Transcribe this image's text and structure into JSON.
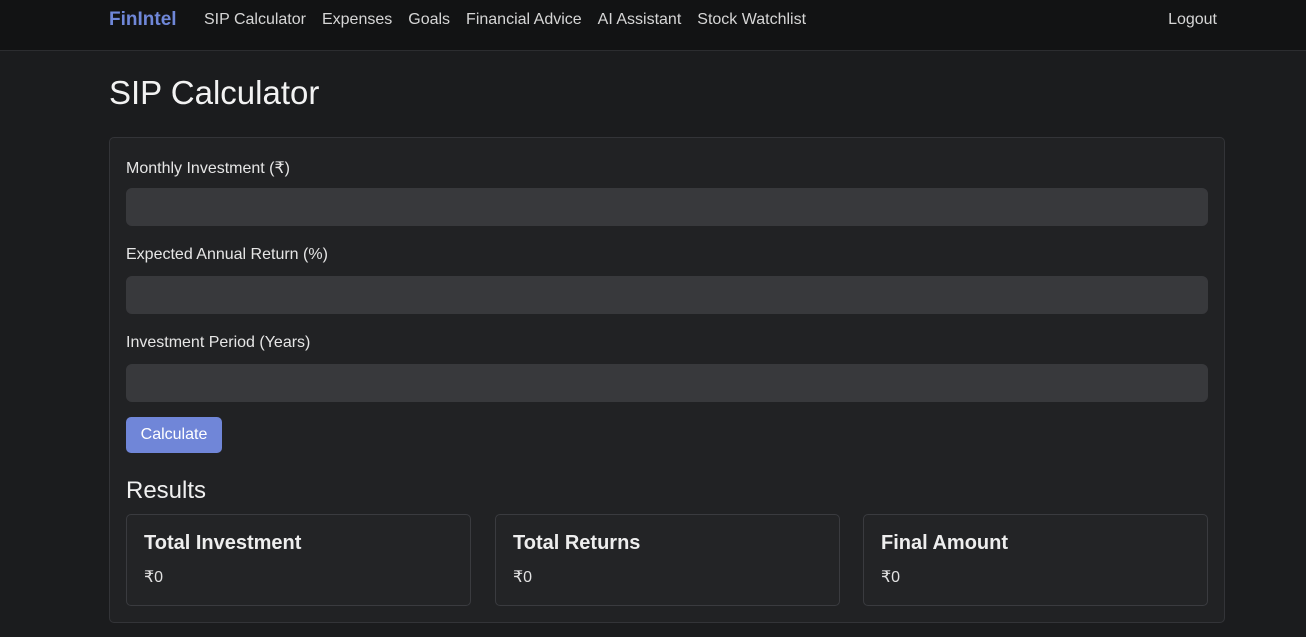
{
  "nav": {
    "brand": "FinIntel",
    "links": [
      {
        "label": "SIP Calculator"
      },
      {
        "label": "Expenses"
      },
      {
        "label": "Goals"
      },
      {
        "label": "Financial Advice"
      },
      {
        "label": "AI Assistant"
      },
      {
        "label": "Stock Watchlist"
      }
    ],
    "logout": "Logout"
  },
  "page": {
    "title": "SIP Calculator"
  },
  "form": {
    "monthly_investment": {
      "label": "Monthly Investment (₹)",
      "value": "",
      "placeholder": ""
    },
    "annual_return": {
      "label": "Expected Annual Return (%)",
      "value": "",
      "placeholder": ""
    },
    "period": {
      "label": "Investment Period (Years)",
      "value": "",
      "placeholder": ""
    },
    "calculate_label": "Calculate"
  },
  "results": {
    "title": "Results",
    "items": [
      {
        "title": "Total Investment",
        "value": "₹0"
      },
      {
        "title": "Total Returns",
        "value": "₹0"
      },
      {
        "title": "Final Amount",
        "value": "₹0"
      }
    ]
  },
  "colors": {
    "accent": "#7086d8",
    "brand": "#6f87d8",
    "background": "#1b1c1e",
    "navbar": "#121314",
    "card": "#212224",
    "input": "#38393c"
  }
}
